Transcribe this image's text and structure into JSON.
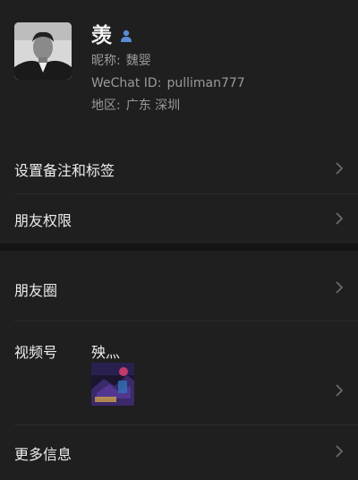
{
  "profile": {
    "name": "羡",
    "nickname_label": "昵称:",
    "nickname": "魏婴",
    "wechat_id_label": "WeChat ID:",
    "wechat_id": "pulliman777",
    "region_label": "地区:",
    "region": "广东  深圳",
    "gender_icon": "male-user-icon"
  },
  "menu": {
    "remark_tags": "设置备注和标签",
    "friend_permissions": "朋友权限",
    "moments": "朋友圈",
    "channels_label": "视频号",
    "channels_name": "殃灬",
    "more_info": "更多信息"
  },
  "colors": {
    "background": "#1f1f1f",
    "section_gap": "#141414",
    "accent_icon": "#5b8bd6"
  }
}
